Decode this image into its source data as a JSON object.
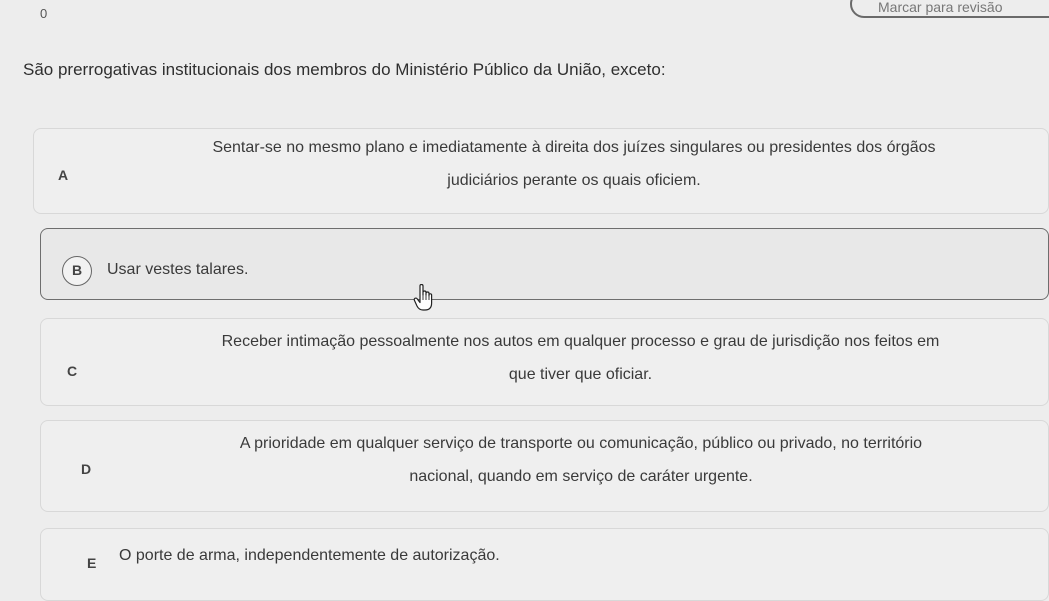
{
  "header": {
    "number": "0",
    "review_label": "Marcar para revisão"
  },
  "question": {
    "text": "São prerrogativas institucionais dos membros do Ministério Público da União, exceto:"
  },
  "options": [
    {
      "letter": "A",
      "line1": "Sentar-se no mesmo plano e imediatamente à direita dos juízes singulares ou presidentes dos órgãos",
      "line2": "judiciários perante os quais oficiem."
    },
    {
      "letter": "B",
      "line1": "Usar vestes talares.",
      "selected": true
    },
    {
      "letter": "C",
      "line1": "Receber intimação pessoalmente nos autos em qualquer processo e grau de jurisdição nos feitos em",
      "line2": "que tiver que oficiar."
    },
    {
      "letter": "D",
      "line1": "A prioridade em qualquer serviço de transporte ou comunicação, público ou privado, no território",
      "line2": "nacional, quando em serviço de caráter urgente."
    },
    {
      "letter": "E",
      "line1": "O porte de arma, independentemente de autorização."
    }
  ],
  "icons": {
    "cursor": "hand-pointer-icon"
  }
}
